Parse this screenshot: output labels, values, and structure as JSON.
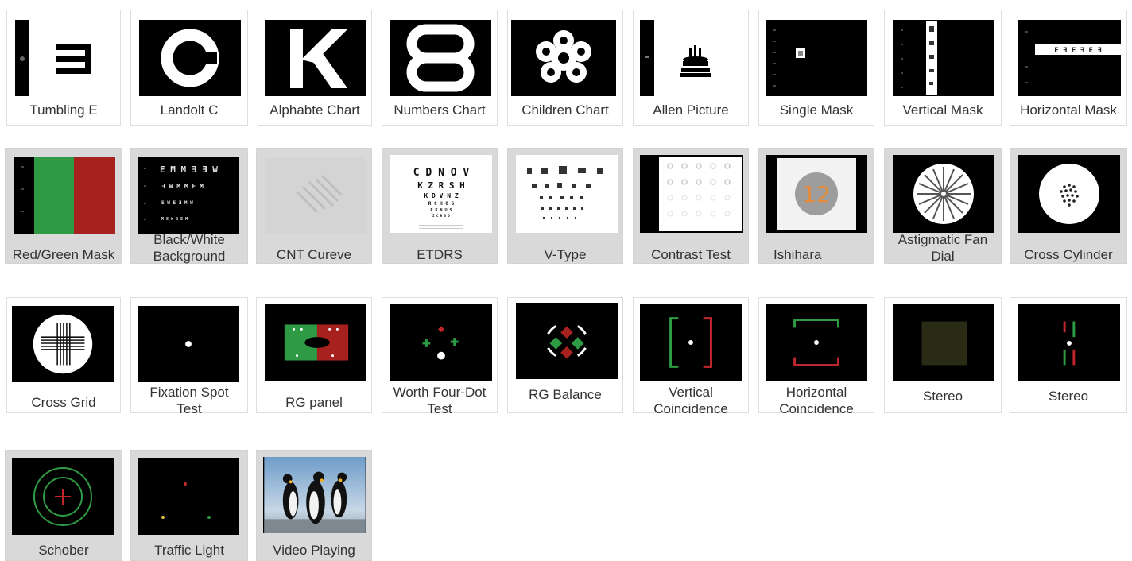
{
  "tiles": [
    {
      "label": "Tumbling E",
      "thumb": "tumbling-e-chart",
      "row": 1
    },
    {
      "label": "Landolt C",
      "thumb": "landolt-c-chart",
      "row": 1
    },
    {
      "label": "Alphabte Chart",
      "thumb": "alphabet-chart",
      "row": 1
    },
    {
      "label": "Numbers Chart",
      "thumb": "numbers-chart",
      "row": 1
    },
    {
      "label": "Children Chart",
      "thumb": "children-chart",
      "row": 1
    },
    {
      "label": "Allen Picture",
      "thumb": "allen-picture-chart",
      "row": 1
    },
    {
      "label": "Single Mask",
      "thumb": "single-mask",
      "row": 1
    },
    {
      "label": "Vertical Mask",
      "thumb": "vertical-mask",
      "row": 1
    },
    {
      "label": "Horizontal Mask",
      "thumb": "horizontal-mask",
      "row": 1
    },
    {
      "label": "Red/Green Mask",
      "thumb": "red-green-mask",
      "row": 2
    },
    {
      "label": "Black/White\nBackground",
      "thumb": "black-white-background",
      "row": 2
    },
    {
      "label": "CNT Cureve",
      "thumb": "cnt-curve",
      "row": 2
    },
    {
      "label": "ETDRS",
      "thumb": "etdrs-chart",
      "row": 2
    },
    {
      "label": "V-Type",
      "thumb": "v-type-chart",
      "row": 2
    },
    {
      "label": "Contrast Test",
      "thumb": "contrast-test",
      "row": 2
    },
    {
      "label": "Ishihara",
      "thumb": "ishihara-plate",
      "row": 2
    },
    {
      "label": "Astigmatic Fan\nDial",
      "thumb": "astigmatic-fan-dial",
      "row": 2
    },
    {
      "label": "Cross Cylinder",
      "thumb": "cross-cylinder",
      "row": 2
    },
    {
      "label": "Cross Grid",
      "thumb": "cross-grid",
      "row": 3
    },
    {
      "label": "Fixation Spot\nTest",
      "thumb": "fixation-spot",
      "row": 3
    },
    {
      "label": "RG panel",
      "thumb": "rg-panel",
      "row": 3
    },
    {
      "label": "Worth Four-Dot\nTest",
      "thumb": "worth-four-dot",
      "row": 3
    },
    {
      "label": "RG Balance",
      "thumb": "rg-balance",
      "row": 3
    },
    {
      "label": "Vertical\nCoincidence",
      "thumb": "vertical-coincidence",
      "row": 3
    },
    {
      "label": "Horizontal\nCoincidence",
      "thumb": "horizontal-coincidence",
      "row": 3
    },
    {
      "label": "Stereo",
      "thumb": "stereo-square",
      "row": 3
    },
    {
      "label": "Stereo",
      "thumb": "stereo-lines",
      "row": 3
    },
    {
      "label": "Schober",
      "thumb": "schober",
      "row": 4
    },
    {
      "label": "Traffic Light",
      "thumb": "traffic-light",
      "row": 4
    },
    {
      "label": "Video Playing",
      "thumb": "video-penguins",
      "row": 4
    }
  ],
  "chart_text": {
    "etdrs_lines": [
      "C D N O V",
      "K Z R S H",
      "K D V N Z",
      "R C H O S",
      "R K N U S",
      "Z C R S D"
    ],
    "horizontal_mask_letters": "E   ∃   E   ∃   E   ∃",
    "ishihara_number": "12"
  },
  "colors": {
    "red": "#a7211e",
    "green": "#2e9a43",
    "ishihara_circle": "#9d9d9d",
    "ishihara_number": "#e48a3c"
  }
}
